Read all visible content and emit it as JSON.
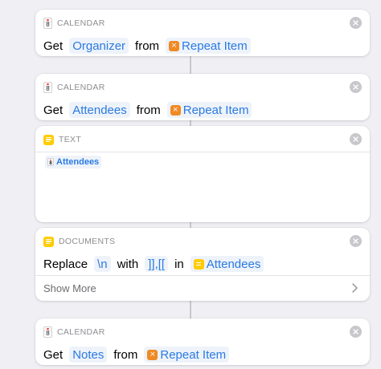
{
  "colors": {
    "background": "#efeff4",
    "accent": "#2a7ae2",
    "calendar_red": "#ff3b30",
    "variable_orange": "#f08a24",
    "notes_yellow": "#ffcc00"
  },
  "actions": [
    {
      "category": "CALENDAR",
      "icon": "calendar-icon",
      "calendar_day": "8",
      "get_label": "Get",
      "property": "Organizer",
      "from_label": "from",
      "variable_icon": "repeat-item-variable-icon",
      "variable": "Repeat Item"
    },
    {
      "category": "CALENDAR",
      "icon": "calendar-icon",
      "calendar_day": "8",
      "get_label": "Get",
      "property": "Attendees",
      "from_label": "from",
      "variable_icon": "repeat-item-variable-icon",
      "variable": "Repeat Item"
    },
    {
      "category": "TEXT",
      "icon": "text-note-icon",
      "token_icon": "calendar-icon",
      "calendar_day": "8",
      "token": "Attendees"
    },
    {
      "category": "DOCUMENTS",
      "icon": "documents-note-icon",
      "replace_label": "Replace",
      "find": "\\n",
      "with_label": "with",
      "replacement": "]],[[",
      "in_label": "in",
      "variable_icon": "text-variable-icon",
      "variable": "Attendees",
      "show_more": "Show More"
    },
    {
      "category": "CALENDAR",
      "icon": "calendar-icon",
      "calendar_day": "8",
      "get_label": "Get",
      "property": "Notes",
      "from_label": "from",
      "variable_icon": "repeat-item-variable-icon",
      "variable": "Repeat Item"
    }
  ]
}
